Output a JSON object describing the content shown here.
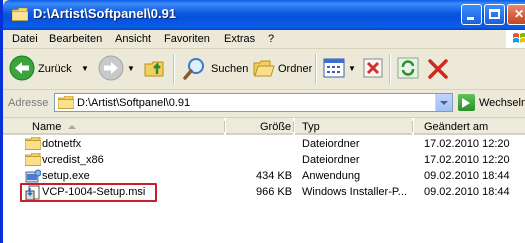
{
  "window": {
    "title": "D:\\Artist\\Softpanel\\0.91"
  },
  "menu": {
    "items": [
      "Datei",
      "Bearbeiten",
      "Ansicht",
      "Favoriten",
      "Extras",
      "?"
    ]
  },
  "toolbar": {
    "back_label": "Zurück",
    "search_label": "Suchen",
    "folders_label": "Ordner"
  },
  "address": {
    "label": "Adresse",
    "value": "D:\\Artist\\Softpanel\\0.91",
    "go_label": "Wechseln zu"
  },
  "columns": {
    "name": "Name",
    "size": "Größe",
    "type": "Typ",
    "modified": "Geändert am"
  },
  "files": [
    {
      "name": "dotnetfx",
      "size": "",
      "type": "Dateiordner",
      "modified": "17.02.2010 12:20",
      "icon": "folder-icon"
    },
    {
      "name": "vcredist_x86",
      "size": "",
      "type": "Dateiordner",
      "modified": "17.02.2010 12:20",
      "icon": "folder-icon"
    },
    {
      "name": "setup.exe",
      "size": "434 KB",
      "type": "Anwendung",
      "modified": "09.02.2010 18:44",
      "icon": "setup-exe-icon"
    },
    {
      "name": "VCP-1004-Setup.msi",
      "size": "966 KB",
      "type": "Windows Installer-P...",
      "modified": "09.02.2010 18:44",
      "icon": "msi-installer-icon"
    }
  ],
  "colors": {
    "titlebar": "#0a5ee8",
    "highlight_box": "#c4202a",
    "window_bg": "#ece9d8"
  }
}
